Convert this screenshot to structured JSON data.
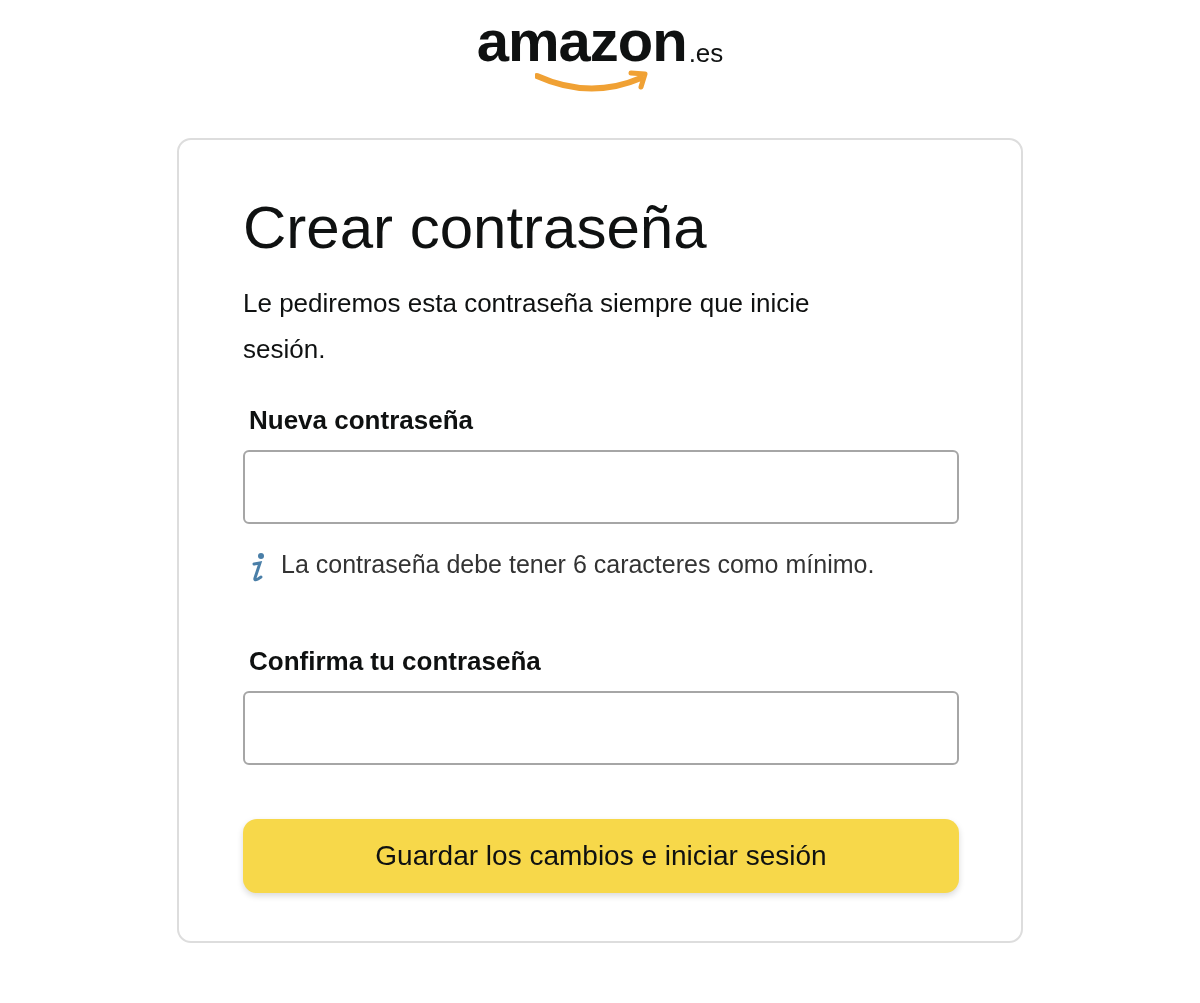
{
  "logo": {
    "name": "amazon",
    "suffix": ".es"
  },
  "card": {
    "title": "Crear contraseña",
    "subtitle": "Le pediremos esta contraseña siempre que inicie sesión.",
    "fields": [
      {
        "label": "Nueva contraseña",
        "hint": "La contraseña debe tener 6 caracteres como mínimo."
      },
      {
        "label": "Confirma tu contraseña"
      }
    ],
    "submit": "Guardar los cambios e iniciar sesión"
  }
}
